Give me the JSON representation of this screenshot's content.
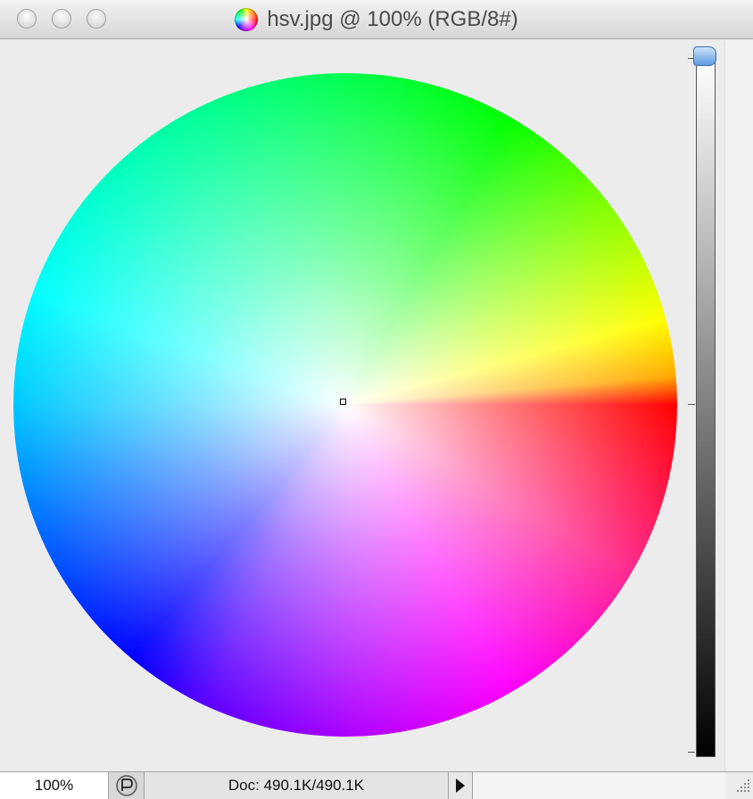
{
  "window": {
    "title": "hsv.jpg @ 100% (RGB/8#)",
    "doc_icon": "color-wheel-icon"
  },
  "canvas": {
    "image": "hsv color wheel"
  },
  "status": {
    "zoom": "100%",
    "doc_info": "Doc: 490.1K/490.1K",
    "menu_arrow": "play-triangle-icon"
  },
  "colors": {
    "titlebar": "#dcdcdc",
    "canvas_bg": "#ececec",
    "slider_thumb": "#5d9ae0"
  }
}
